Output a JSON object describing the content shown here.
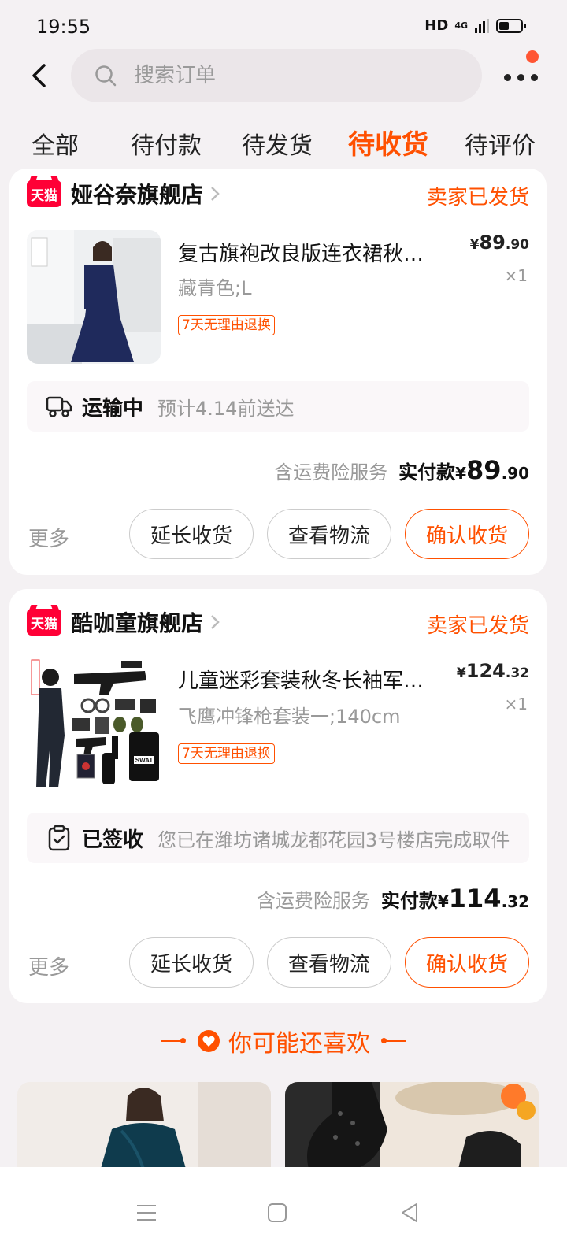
{
  "status_bar": {
    "time": "19:55",
    "hd": "HD",
    "network": "4G"
  },
  "header": {
    "search_placeholder": "搜索订单"
  },
  "tabs": [
    {
      "label": "全部",
      "active": false
    },
    {
      "label": "待付款",
      "active": false
    },
    {
      "label": "待发货",
      "active": false
    },
    {
      "label": "待收货",
      "active": true
    },
    {
      "label": "待评价",
      "active": false
    }
  ],
  "orders": [
    {
      "shop_badge": "天猫",
      "shop_name": "娅谷奈旗舰店",
      "ship_status": "卖家已发货",
      "product_name": "复古旗袍改良版连衣裙秋冬季新款长袖",
      "product_spec": "藏青色;L",
      "return_tag": "7天无理由退换",
      "price_yen": "¥",
      "price_int": "89",
      "price_dec": ".90",
      "quantity": "×1",
      "logistics_state": "运输中",
      "logistics_desc": "预计4.14前送达",
      "service_text": "含运费险服务",
      "paid_label": "实付款",
      "paid_yen": "¥",
      "paid_int": "89",
      "paid_dec": ".90",
      "more": "更多",
      "btn_extend": "延长收货",
      "btn_logistics": "查看物流",
      "btn_confirm": "确认收货"
    },
    {
      "shop_badge": "天猫",
      "shop_name": "酷咖童旗舰店",
      "ship_status": "卖家已发货",
      "product_name": "儿童迷彩套装秋冬长袖军训服特种兵",
      "product_spec": "飞鹰冲锋枪套装一;140cm",
      "return_tag": "7天无理由退换",
      "price_yen": "¥",
      "price_int": "124",
      "price_dec": ".32",
      "quantity": "×1",
      "logistics_state": "已签收",
      "logistics_desc": "您已在潍坊诸城龙都花园3号楼店完成取件",
      "service_text": "含运费险服务",
      "paid_label": "实付款",
      "paid_yen": "¥",
      "paid_int": "114",
      "paid_dec": ".32",
      "more": "更多",
      "btn_extend": "延长收货",
      "btn_logistics": "查看物流",
      "btn_confirm": "确认收货"
    }
  ],
  "recommend": {
    "title": "你可能还喜欢"
  },
  "colors": {
    "accent": "#ff5000",
    "tmall": "#ff0036",
    "background": "#f4f1f3"
  },
  "icons": {
    "back": "back-arrow-icon",
    "search": "search-icon",
    "more": "more-dots-icon",
    "truck": "truck-icon",
    "signed": "clipboard-check-icon",
    "heart": "heart-icon"
  }
}
